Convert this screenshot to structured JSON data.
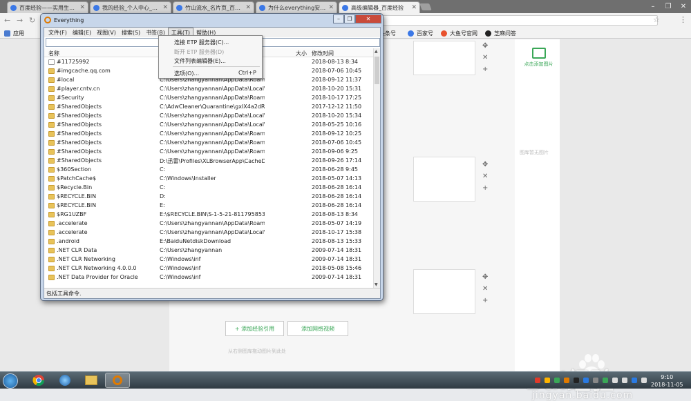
{
  "browser": {
    "tabs": [
      {
        "label": "百度经验——实用生活指",
        "active": false
      },
      {
        "label": "我的经验_个人中心_百度",
        "active": false
      },
      {
        "label": "竹山流水_名片页_百度经",
        "active": false
      },
      {
        "label": "为什么everything安装了",
        "active": false
      },
      {
        "label": "高级编辑器_百度经验",
        "active": true
      }
    ],
    "apps_label": "应用",
    "bookmarks": [
      "头条号",
      "百家号",
      "大鱼号官网",
      "芝麻问答"
    ]
  },
  "page": {
    "add_image_label": "点击添加图片",
    "no_image_label": "图库暂无图片",
    "add_reference_button": "+ 添加经验引用",
    "add_video_button": "添加网络视频",
    "drag_hint": "从右侧图库拖动图片到此处",
    "watermark_logo": "Bai经验",
    "watermark_url": "jingyan.baidu.com"
  },
  "everything": {
    "title": "Everything",
    "menus": [
      "文件(F)",
      "编辑(E)",
      "视图(V)",
      "搜索(S)",
      "书签(B)",
      "工具(T)",
      "帮助(H)"
    ],
    "open_menu_index": 5,
    "columns": {
      "name": "名称",
      "path": "路",
      "size": "大小",
      "date": "修改时间"
    },
    "rows": [
      {
        "name": "#11725992",
        "path": "E",
        "date": "2018-08-13 8:34",
        "type": "file"
      },
      {
        "name": "#imgcache.qq.com",
        "path": "C",
        "date": "2018-07-06 10:45",
        "type": "folder"
      },
      {
        "name": "#local",
        "path": "C:\\Users\\zhangyannan\\AppData\\Roamin...",
        "date": "2018-09-12 11:37",
        "type": "folder"
      },
      {
        "name": "#player.cntv.cn",
        "path": "C:\\Users\\zhangyannan\\AppData\\Local\\G...",
        "date": "2018-10-20 15:31",
        "type": "folder"
      },
      {
        "name": "#Security",
        "path": "C:\\Users\\zhangyannan\\AppData\\Roamin...",
        "date": "2018-10-17 17:25",
        "type": "folder"
      },
      {
        "name": "#SharedObjects",
        "path": "C:\\AdwCleaner\\Quarantine\\gxIX4a2dRE\\...",
        "date": "2017-12-12 11:50",
        "type": "folder"
      },
      {
        "name": "#SharedObjects",
        "path": "C:\\Users\\zhangyannan\\AppData\\Local\\G...",
        "date": "2018-10-20 15:34",
        "type": "folder"
      },
      {
        "name": "#SharedObjects",
        "path": "C:\\Users\\zhangyannan\\AppData\\Local\\G...",
        "date": "2018-05-25 10:16",
        "type": "folder"
      },
      {
        "name": "#SharedObjects",
        "path": "C:\\Users\\zhangyannan\\AppData\\Roamin...",
        "date": "2018-09-12 10:25",
        "type": "folder"
      },
      {
        "name": "#SharedObjects",
        "path": "C:\\Users\\zhangyannan\\AppData\\Roamin...",
        "date": "2018-07-06 10:45",
        "type": "folder"
      },
      {
        "name": "#SharedObjects",
        "path": "C:\\Users\\zhangyannan\\AppData\\Roamin...",
        "date": "2018-09-06 9:25",
        "type": "folder"
      },
      {
        "name": "#SharedObjects",
        "path": "D:\\迅雷\\Profiles\\XLBrowserApp\\CacheDa...",
        "date": "2018-09-26 17:14",
        "type": "folder"
      },
      {
        "name": "$360Section",
        "path": "C:",
        "date": "2018-06-28 9:45",
        "type": "folder"
      },
      {
        "name": "$PatchCache$",
        "path": "C:\\Windows\\Installer",
        "date": "2018-05-07 14:13",
        "type": "folder"
      },
      {
        "name": "$Recycle.Bin",
        "path": "C:",
        "date": "2018-06-28 16:14",
        "type": "folder"
      },
      {
        "name": "$RECYCLE.BIN",
        "path": "D:",
        "date": "2018-06-28 16:14",
        "type": "folder"
      },
      {
        "name": "$RECYCLE.BIN",
        "path": "E:",
        "date": "2018-06-28 16:14",
        "type": "folder"
      },
      {
        "name": "$RG1UZBF",
        "path": "E:\\$RECYCLE.BIN\\S-1-5-21-811795853-3...",
        "date": "2018-08-13 8:34",
        "type": "folder"
      },
      {
        "name": ".accelerate",
        "path": "C:\\Users\\zhangyannan\\AppData\\Roamin...",
        "date": "2018-05-07 14:19",
        "type": "folder"
      },
      {
        "name": ".accelerate",
        "path": "C:\\Users\\zhangyannan\\AppData\\Local\\B...",
        "date": "2018-10-17 15:38",
        "type": "folder"
      },
      {
        "name": ".android",
        "path": "E:\\BaiduNetdiskDownload",
        "date": "2018-08-13 15:33",
        "type": "folder"
      },
      {
        "name": ".NET CLR Data",
        "path": "C:\\Users\\zhangyannan",
        "date": "2009-07-14 18:31",
        "type": "folder"
      },
      {
        "name": ".NET CLR Networking",
        "path": "C:\\Windows\\inf",
        "date": "2009-07-14 18:31",
        "type": "folder"
      },
      {
        "name": ".NET CLR Networking 4.0.0.0",
        "path": "C:\\Windows\\inf",
        "date": "2018-05-08 15:46",
        "type": "folder"
      },
      {
        "name": ".NET Data Provider for Oracle",
        "path": "C:\\Windows\\inf",
        "date": "2009-07-14 18:31",
        "type": "folder"
      }
    ],
    "status": "包括工具命令.",
    "tools_menu": [
      {
        "label": "连接 ETP 服务器(C)...",
        "shortcut": "",
        "disabled": false
      },
      {
        "label": "断开 ETP 服务器(D)",
        "shortcut": "",
        "disabled": true
      },
      {
        "label": "文件列表编辑器(E)...",
        "shortcut": "",
        "disabled": false
      },
      {
        "label": "选项(O)...",
        "shortcut": "Ctrl+P",
        "disabled": false
      }
    ]
  },
  "taskbar": {
    "time": "9:10",
    "date": "2018-11-05"
  },
  "colors": {
    "accent_green": "#3aa757",
    "title_bar": "#c7d6ea"
  }
}
